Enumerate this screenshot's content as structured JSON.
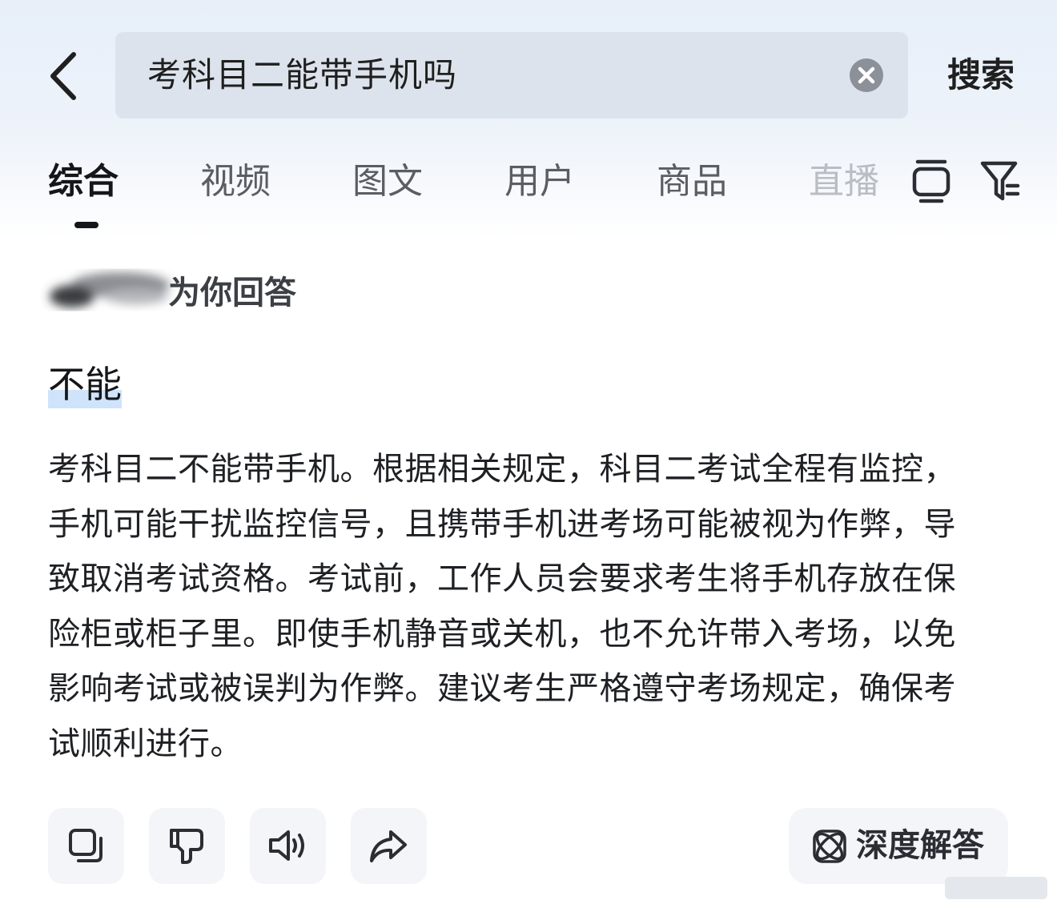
{
  "header": {
    "search_query": "考科目二能带手机吗",
    "search_button": "搜索"
  },
  "tabs": [
    {
      "label": "综合"
    },
    {
      "label": "视频"
    },
    {
      "label": "图文"
    },
    {
      "label": "用户"
    },
    {
      "label": "商品"
    },
    {
      "label": "直播"
    }
  ],
  "answer": {
    "answered_by": "为你回答",
    "verdict": "不能",
    "body": "考科目二不能带手机。根据相关规定，科目二考试全程有监控，手机可能干扰监控信号，且携带手机进考场可能被视为作弊，导致取消考试资格。考试前，工作人员会要求考生将手机存放在保险柜或柜子里。即使手机静音或关机，也不允许带入考场，以免影响考试或被误判为作弊。建议考生严格遵守考场规定，确保考试顺利进行。",
    "deep_answer_label": "深度解答"
  },
  "icons": {
    "back": "chevron-left-icon",
    "clear": "clear-circle-icon",
    "collapse": "layers-icon",
    "filter": "filter-icon",
    "copy": "copy-icon",
    "dislike": "thumbs-down-icon",
    "speak": "speaker-icon",
    "share": "share-arrow-icon",
    "deep": "atom-icon"
  },
  "colors": {
    "accent_highlight": "#cfe4fb",
    "active_tab": "#14161a",
    "inactive_tab": "#5a5d63",
    "search_field_bg": "#dde3ec"
  }
}
